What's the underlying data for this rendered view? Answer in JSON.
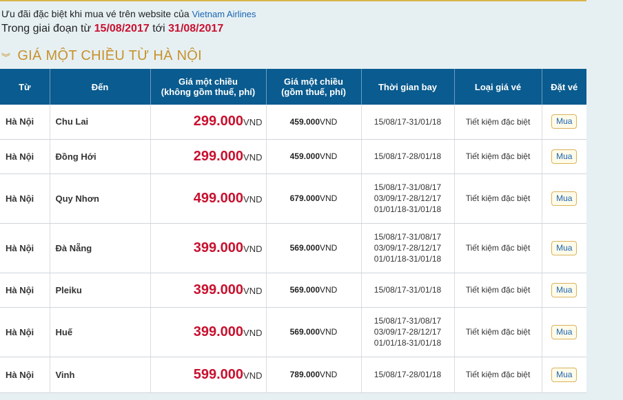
{
  "intro": {
    "line1_text": "Ưu đãi đặc biệt khi mua vé trên website của",
    "line1_link": "Vietnam Airlines",
    "line2_prefix": "Trong giai đoạn từ",
    "start_date": "15/08/2017",
    "connector": "tới",
    "end_date": "31/08/2017"
  },
  "section": {
    "title": "GIÁ MỘT CHIỀU TỪ HÀ NỘI"
  },
  "table": {
    "headers": {
      "from": "Từ",
      "to": "Đến",
      "price_net_1": "Giá một chiều",
      "price_net_2": "(không gồm thuế, phí)",
      "price_gross_1": "Giá một chiều",
      "price_gross_2": "(gồm thuế, phí)",
      "dates": "Thời gian bay",
      "fare_type": "Loại giá vé",
      "book": "Đặt vé"
    },
    "rows": [
      {
        "from": "Hà Nội",
        "to": "Chu Lai",
        "price": "299.000",
        "unit": "VND",
        "price_gross": "459.000",
        "unit_gross": "VND",
        "dates": [
          "15/08/17-31/01/18"
        ],
        "fare_type": "Tiết kiệm đặc biệt",
        "buy": "Mua"
      },
      {
        "from": "Hà Nội",
        "to": "Đồng Hới",
        "price": "299.000",
        "unit": "VND",
        "price_gross": "459.000",
        "unit_gross": "VND",
        "dates": [
          "15/08/17-28/01/18"
        ],
        "fare_type": "Tiết kiệm đặc biệt",
        "buy": "Mua"
      },
      {
        "from": "Hà Nội",
        "to": "Quy Nhơn",
        "price": "499.000",
        "unit": "VND",
        "price_gross": "679.000",
        "unit_gross": "VND",
        "dates": [
          "15/08/17-31/08/17",
          "03/09/17-28/12/17",
          "01/01/18-31/01/18"
        ],
        "fare_type": "Tiết kiệm đặc biệt",
        "buy": "Mua"
      },
      {
        "from": "Hà Nội",
        "to": "Đà Nẵng",
        "price": "399.000",
        "unit": "VND",
        "price_gross": "569.000",
        "unit_gross": "VND",
        "dates": [
          "15/08/17-31/08/17",
          "03/09/17-28/12/17",
          "01/01/18-31/01/18"
        ],
        "fare_type": "Tiết kiệm đặc biệt",
        "buy": "Mua"
      },
      {
        "from": "Hà Nội",
        "to": "Pleiku",
        "price": "399.000",
        "unit": "VND",
        "price_gross": "569.000",
        "unit_gross": "VND",
        "dates": [
          "15/08/17-31/01/18"
        ],
        "fare_type": "Tiết kiệm đặc biệt",
        "buy": "Mua"
      },
      {
        "from": "Hà Nội",
        "to": "Huế",
        "price": "399.000",
        "unit": "VND",
        "price_gross": "569.000",
        "unit_gross": "VND",
        "dates": [
          "15/08/17-31/08/17",
          "03/09/17-28/12/17",
          "01/01/18-31/01/18"
        ],
        "fare_type": "Tiết kiệm đặc biệt",
        "buy": "Mua"
      },
      {
        "from": "Hà Nội",
        "to": "Vinh",
        "price": "599.000",
        "unit": "VND",
        "price_gross": "789.000",
        "unit_gross": "VND",
        "dates": [
          "15/08/17-28/01/18"
        ],
        "fare_type": "Tiết kiệm đặc biệt",
        "buy": "Mua"
      }
    ]
  },
  "colors": {
    "header_bg": "#0a5b8f",
    "price_red": "#c8102e",
    "title_gold": "#c8912a",
    "link_blue": "#1a64b4"
  }
}
